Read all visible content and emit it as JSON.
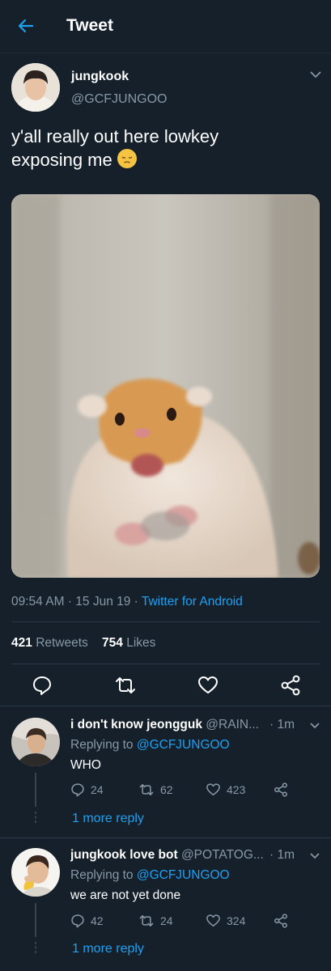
{
  "header": {
    "title": "Tweet"
  },
  "tweet": {
    "author_name": "jungkook",
    "author_handle": "@GCFJUNGOO",
    "text_line1": "y'all really out here lowkey",
    "text_line2": "exposing me",
    "emoji": "pensive-face",
    "time": "09:54 AM",
    "date": "15 Jun 19",
    "source": "Twitter for Android",
    "retweets_count": "421",
    "retweets_label": "Retweets",
    "likes_count": "754",
    "likes_label": "Likes"
  },
  "replies": [
    {
      "name": "i don't know jeongguk",
      "handle": "@RAIN...",
      "time": "1m",
      "replying_prefix": "Replying to",
      "replying_handle": "@GCFJUNGOO",
      "text": "WHO",
      "reply_count": "24",
      "retweet_count": "62",
      "like_count": "423",
      "more_label": "1 more reply"
    },
    {
      "name": "jungkook love bot",
      "handle": "@POTATOG...",
      "time": "1m",
      "replying_prefix": "Replying to",
      "replying_handle": "@GCFJUNGOO",
      "text": "we are not yet done",
      "reply_count": "42",
      "retweet_count": "24",
      "like_count": "324",
      "more_label": "1 more reply"
    }
  ],
  "colors": {
    "background": "#15202b",
    "accent": "#1da1f2",
    "secondary_text": "#8899a6"
  }
}
